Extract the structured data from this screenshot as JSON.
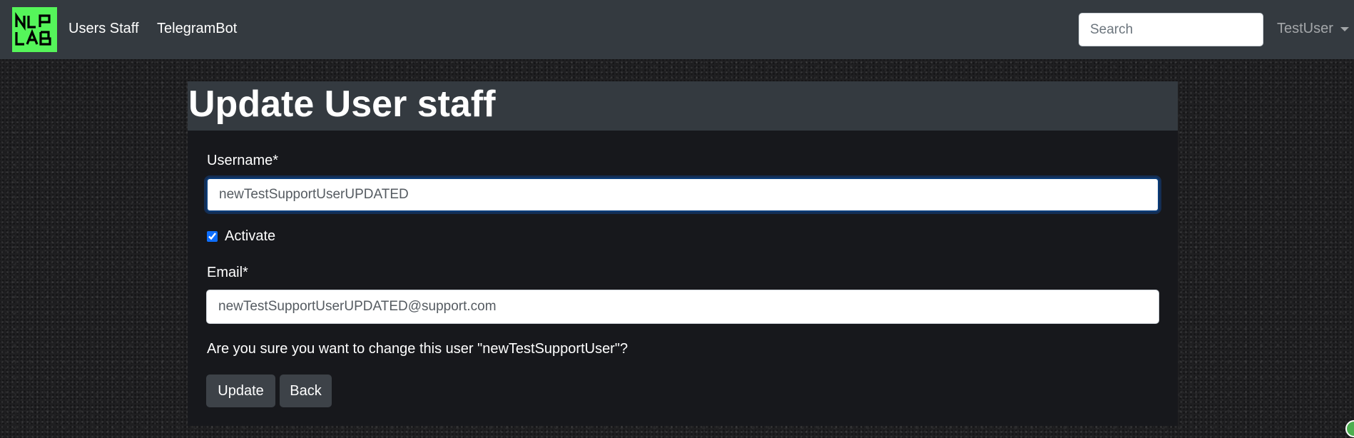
{
  "navbar": {
    "logo_text": "NLP LAB",
    "logo_color": "#55f55a",
    "links": [
      {
        "label": "Users Staff"
      },
      {
        "label": "TelegramBot"
      }
    ],
    "search_placeholder": "Search",
    "user_menu_label": "TestUser"
  },
  "form": {
    "title": "Update User staff",
    "username_label": "Username*",
    "username_value": "newTestSupportUserUPDATED",
    "activate_label": "Activate",
    "activate_checked": true,
    "email_label": "Email*",
    "email_value": "newTestSupportUserUPDATED@support.com",
    "confirm_text": "Are you sure you want to change this user \"newTestSupportUser\"?",
    "update_button": "Update",
    "back_button": "Back"
  },
  "colors": {
    "navbar_bg": "#343a40",
    "card_bg": "#17181c",
    "button_bg": "#3d4248",
    "focus_border": "#0b3d7a",
    "checkbox_accent": "#0d6efd"
  }
}
